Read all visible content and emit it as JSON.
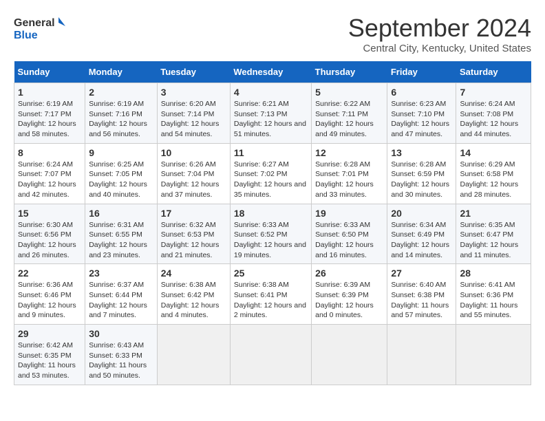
{
  "logo": {
    "line1": "General",
    "line2": "Blue"
  },
  "title": "September 2024",
  "subtitle": "Central City, Kentucky, United States",
  "weekdays": [
    "Sunday",
    "Monday",
    "Tuesday",
    "Wednesday",
    "Thursday",
    "Friday",
    "Saturday"
  ],
  "weeks": [
    [
      {
        "day": "1",
        "sunrise": "6:19 AM",
        "sunset": "7:17 PM",
        "daylight": "12 hours and 58 minutes."
      },
      {
        "day": "2",
        "sunrise": "6:19 AM",
        "sunset": "7:16 PM",
        "daylight": "12 hours and 56 minutes."
      },
      {
        "day": "3",
        "sunrise": "6:20 AM",
        "sunset": "7:14 PM",
        "daylight": "12 hours and 54 minutes."
      },
      {
        "day": "4",
        "sunrise": "6:21 AM",
        "sunset": "7:13 PM",
        "daylight": "12 hours and 51 minutes."
      },
      {
        "day": "5",
        "sunrise": "6:22 AM",
        "sunset": "7:11 PM",
        "daylight": "12 hours and 49 minutes."
      },
      {
        "day": "6",
        "sunrise": "6:23 AM",
        "sunset": "7:10 PM",
        "daylight": "12 hours and 47 minutes."
      },
      {
        "day": "7",
        "sunrise": "6:24 AM",
        "sunset": "7:08 PM",
        "daylight": "12 hours and 44 minutes."
      }
    ],
    [
      {
        "day": "8",
        "sunrise": "6:24 AM",
        "sunset": "7:07 PM",
        "daylight": "12 hours and 42 minutes."
      },
      {
        "day": "9",
        "sunrise": "6:25 AM",
        "sunset": "7:05 PM",
        "daylight": "12 hours and 40 minutes."
      },
      {
        "day": "10",
        "sunrise": "6:26 AM",
        "sunset": "7:04 PM",
        "daylight": "12 hours and 37 minutes."
      },
      {
        "day": "11",
        "sunrise": "6:27 AM",
        "sunset": "7:02 PM",
        "daylight": "12 hours and 35 minutes."
      },
      {
        "day": "12",
        "sunrise": "6:28 AM",
        "sunset": "7:01 PM",
        "daylight": "12 hours and 33 minutes."
      },
      {
        "day": "13",
        "sunrise": "6:28 AM",
        "sunset": "6:59 PM",
        "daylight": "12 hours and 30 minutes."
      },
      {
        "day": "14",
        "sunrise": "6:29 AM",
        "sunset": "6:58 PM",
        "daylight": "12 hours and 28 minutes."
      }
    ],
    [
      {
        "day": "15",
        "sunrise": "6:30 AM",
        "sunset": "6:56 PM",
        "daylight": "12 hours and 26 minutes."
      },
      {
        "day": "16",
        "sunrise": "6:31 AM",
        "sunset": "6:55 PM",
        "daylight": "12 hours and 23 minutes."
      },
      {
        "day": "17",
        "sunrise": "6:32 AM",
        "sunset": "6:53 PM",
        "daylight": "12 hours and 21 minutes."
      },
      {
        "day": "18",
        "sunrise": "6:33 AM",
        "sunset": "6:52 PM",
        "daylight": "12 hours and 19 minutes."
      },
      {
        "day": "19",
        "sunrise": "6:33 AM",
        "sunset": "6:50 PM",
        "daylight": "12 hours and 16 minutes."
      },
      {
        "day": "20",
        "sunrise": "6:34 AM",
        "sunset": "6:49 PM",
        "daylight": "12 hours and 14 minutes."
      },
      {
        "day": "21",
        "sunrise": "6:35 AM",
        "sunset": "6:47 PM",
        "daylight": "12 hours and 11 minutes."
      }
    ],
    [
      {
        "day": "22",
        "sunrise": "6:36 AM",
        "sunset": "6:46 PM",
        "daylight": "12 hours and 9 minutes."
      },
      {
        "day": "23",
        "sunrise": "6:37 AM",
        "sunset": "6:44 PM",
        "daylight": "12 hours and 7 minutes."
      },
      {
        "day": "24",
        "sunrise": "6:38 AM",
        "sunset": "6:42 PM",
        "daylight": "12 hours and 4 minutes."
      },
      {
        "day": "25",
        "sunrise": "6:38 AM",
        "sunset": "6:41 PM",
        "daylight": "12 hours and 2 minutes."
      },
      {
        "day": "26",
        "sunrise": "6:39 AM",
        "sunset": "6:39 PM",
        "daylight": "12 hours and 0 minutes."
      },
      {
        "day": "27",
        "sunrise": "6:40 AM",
        "sunset": "6:38 PM",
        "daylight": "11 hours and 57 minutes."
      },
      {
        "day": "28",
        "sunrise": "6:41 AM",
        "sunset": "6:36 PM",
        "daylight": "11 hours and 55 minutes."
      }
    ],
    [
      {
        "day": "29",
        "sunrise": "6:42 AM",
        "sunset": "6:35 PM",
        "daylight": "11 hours and 53 minutes."
      },
      {
        "day": "30",
        "sunrise": "6:43 AM",
        "sunset": "6:33 PM",
        "daylight": "11 hours and 50 minutes."
      },
      null,
      null,
      null,
      null,
      null
    ]
  ]
}
